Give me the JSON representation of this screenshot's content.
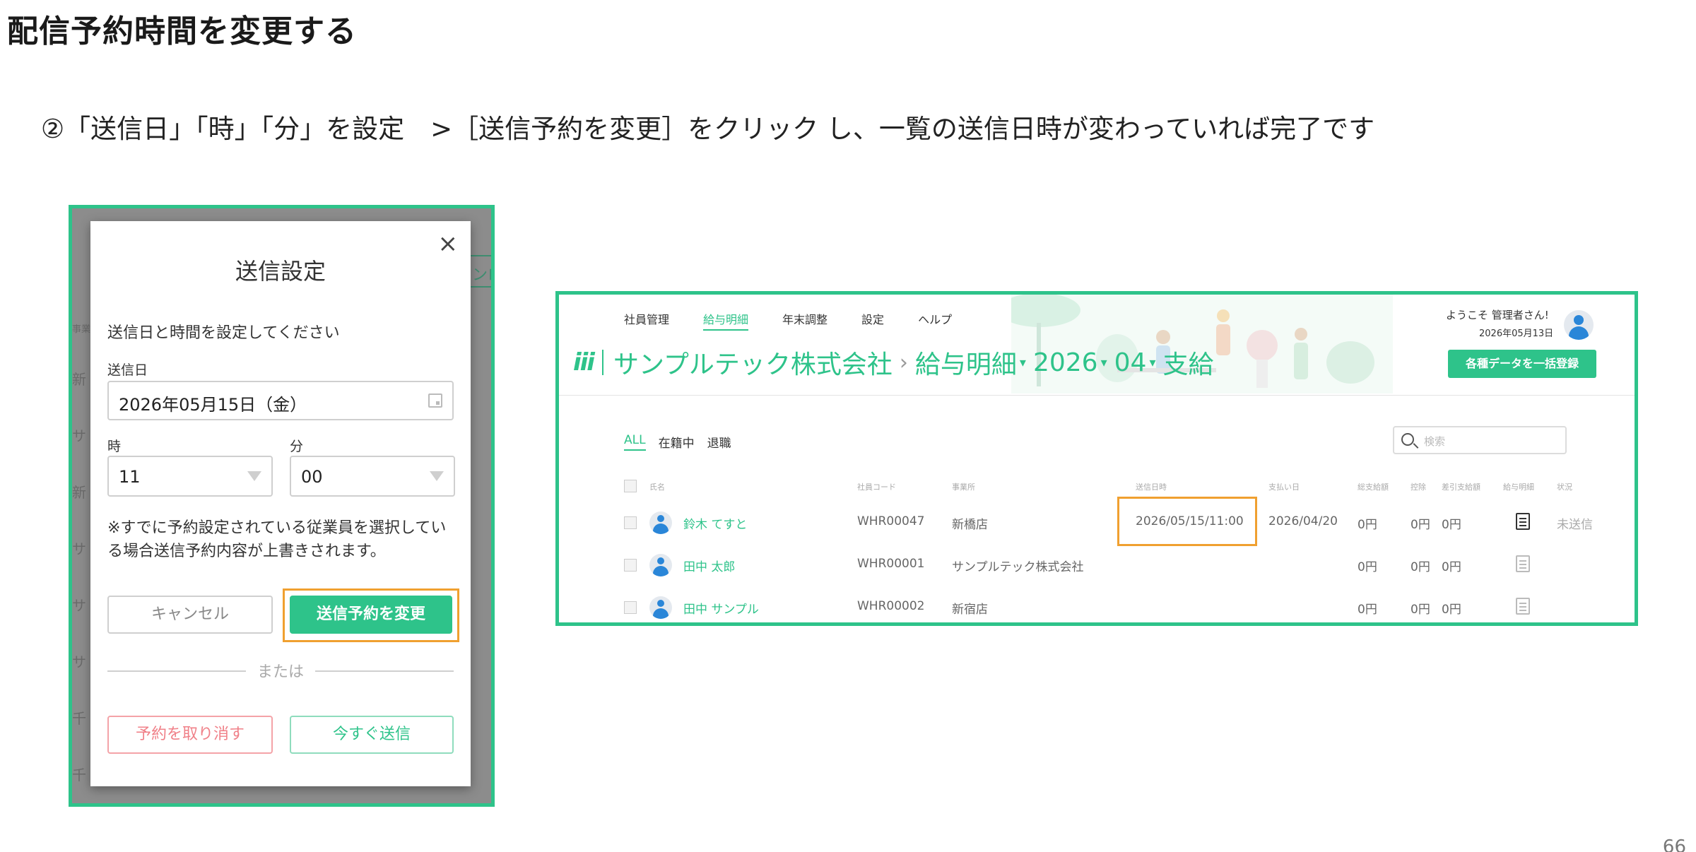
{
  "slide": {
    "title": "配信予約時間を変更する",
    "instruction": "②「送信日」「時」「分」を設定　>［送信予約を変更］をクリック し、一覧の送信日時が変わっていれば完了です",
    "page_number": "66"
  },
  "dialog": {
    "title": "送信設定",
    "close": "×",
    "description": "送信日と時間を設定してください",
    "date_label": "送信日",
    "date_value": "2026年05月15日（金）",
    "hour_label": "時",
    "hour_value": "11",
    "minute_label": "分",
    "minute_value": "00",
    "note": "※すでに予約設定されている従業員を選択している場合送信予約内容が上書きされます。",
    "cancel_label": "キャンセル",
    "change_label": "送信予約を変更",
    "or_label": "または",
    "cancel_reservation_label": "予約を取り消す",
    "send_now_label": "今すぐ送信",
    "background_fragments": [
      "事業",
      "新",
      "サ",
      "新",
      "サ",
      "サ",
      "サ",
      "千",
      "千"
    ],
    "background_button_fragment": "ンロ"
  },
  "app": {
    "nav": [
      "社員管理",
      "給与明細",
      "年末調整",
      "設定",
      "ヘルプ"
    ],
    "nav_active": "給与明細",
    "welcome": "ようこそ 管理者さん!",
    "today": "2026年05月13日",
    "logo": "iii",
    "company": "サンプルテック株式会社",
    "crumb_arrow": "›",
    "section": "給与明細",
    "year": "2026",
    "month": "04",
    "pay_type": "支給",
    "dropdown_symbol": "▾",
    "bulk_button": "各種データを一括登録",
    "filters": [
      "ALL",
      "在籍中",
      "退職"
    ],
    "search_placeholder": "検索",
    "columns": [
      "氏名",
      "社員コード",
      "事業所",
      "送信日時",
      "支払い日",
      "総支給額",
      "控除",
      "差引支給額",
      "給与明細",
      "状況"
    ],
    "rows": [
      {
        "name": "鈴木 てすと",
        "code": "WHR00047",
        "office": "新橋店",
        "send_datetime": "2026/05/15/11:00",
        "pay_date": "2026/04/20",
        "gross": "0円",
        "deduction": "0円",
        "net": "0円",
        "status": "未送信"
      },
      {
        "name": "田中 太郎",
        "code": "WHR00001",
        "office": "サンプルテック株式会社",
        "send_datetime": "",
        "pay_date": "",
        "gross": "0円",
        "deduction": "0円",
        "net": "0円",
        "status": ""
      },
      {
        "name": "田中 サンプル",
        "code": "WHR00002",
        "office": "新宿店",
        "send_datetime": "",
        "pay_date": "",
        "gross": "0円",
        "deduction": "0円",
        "net": "0円",
        "status": ""
      }
    ]
  },
  "colors": {
    "accent": "#2ec38a",
    "highlight": "#f0a030",
    "danger": "#f08088"
  }
}
